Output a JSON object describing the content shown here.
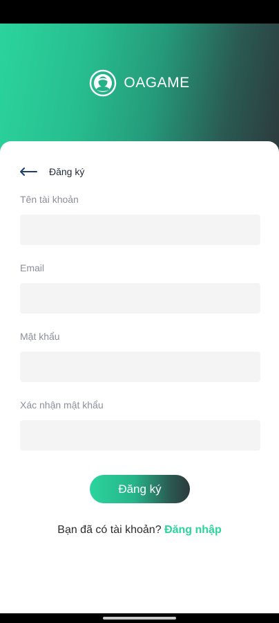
{
  "app": {
    "brand": "OAGAME",
    "logo_icon": "headset-avatar-icon",
    "colors": {
      "accent": "#2bd49c",
      "gradient_end": "#2c3a3c",
      "field_bg": "#f4f4f4",
      "label": "#8b8f99"
    }
  },
  "page": {
    "title": "Đăng ký",
    "back_icon": "arrow-left-icon"
  },
  "form": {
    "fields": [
      {
        "label": "Tên tài khoản",
        "value": "",
        "placeholder": ""
      },
      {
        "label": "Email",
        "value": "",
        "placeholder": ""
      },
      {
        "label": "Mật khẩu",
        "value": "",
        "placeholder": ""
      },
      {
        "label": "Xác nhận mật khẩu",
        "value": "",
        "placeholder": ""
      }
    ],
    "submit_label": "Đăng ký"
  },
  "footer": {
    "prompt": "Bạn đã có tài khoản?",
    "login_link": "Đăng nhập"
  }
}
